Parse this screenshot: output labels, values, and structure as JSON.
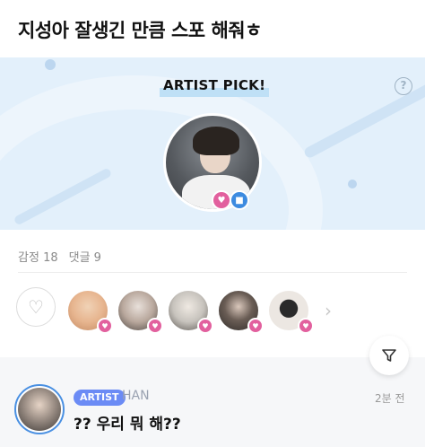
{
  "post": {
    "title": "지성아 잘생긴 만큼 스포 해줘ㅎ"
  },
  "banner": {
    "label_bold": "ARTIST",
    "label_rest": " PICK!",
    "help_glyph": "?",
    "avatar_icon": "artist-photo",
    "badges": [
      {
        "icon": "heart-icon",
        "glyph": "♥",
        "color": "#e2609e"
      },
      {
        "icon": "chat-icon",
        "glyph": "■",
        "color": "#3d8be0"
      }
    ]
  },
  "stats": {
    "emotion_label": "감정",
    "emotion_count": "18",
    "comment_label": "댓글",
    "comment_count": "9"
  },
  "reactions": {
    "like_glyph": "♡",
    "more_glyph": "›",
    "reactors": [
      {
        "avatar": "user-avatar-1",
        "color": "#e7b58f"
      },
      {
        "avatar": "user-avatar-2",
        "color": "#b9a89d"
      },
      {
        "avatar": "user-avatar-3",
        "color": "#c7c3bd"
      },
      {
        "avatar": "user-avatar-4",
        "color": "#2f2b29"
      },
      {
        "avatar": "user-avatar-5",
        "color": "#ece7e2"
      }
    ],
    "badge_glyph": "♥",
    "badge_color": "#e2609e"
  },
  "filter": {
    "glyph": "⊽"
  },
  "comment": {
    "badge": "ARTIST",
    "author": "HAN",
    "time": "2분 전",
    "text": "?? 우리 뭐 해??"
  },
  "colors": {
    "accent_blue": "#4a90e2",
    "artist_badge": "#6b8bf5",
    "heart_pink": "#e2609e",
    "banner_bg": "#e3f0fb"
  }
}
